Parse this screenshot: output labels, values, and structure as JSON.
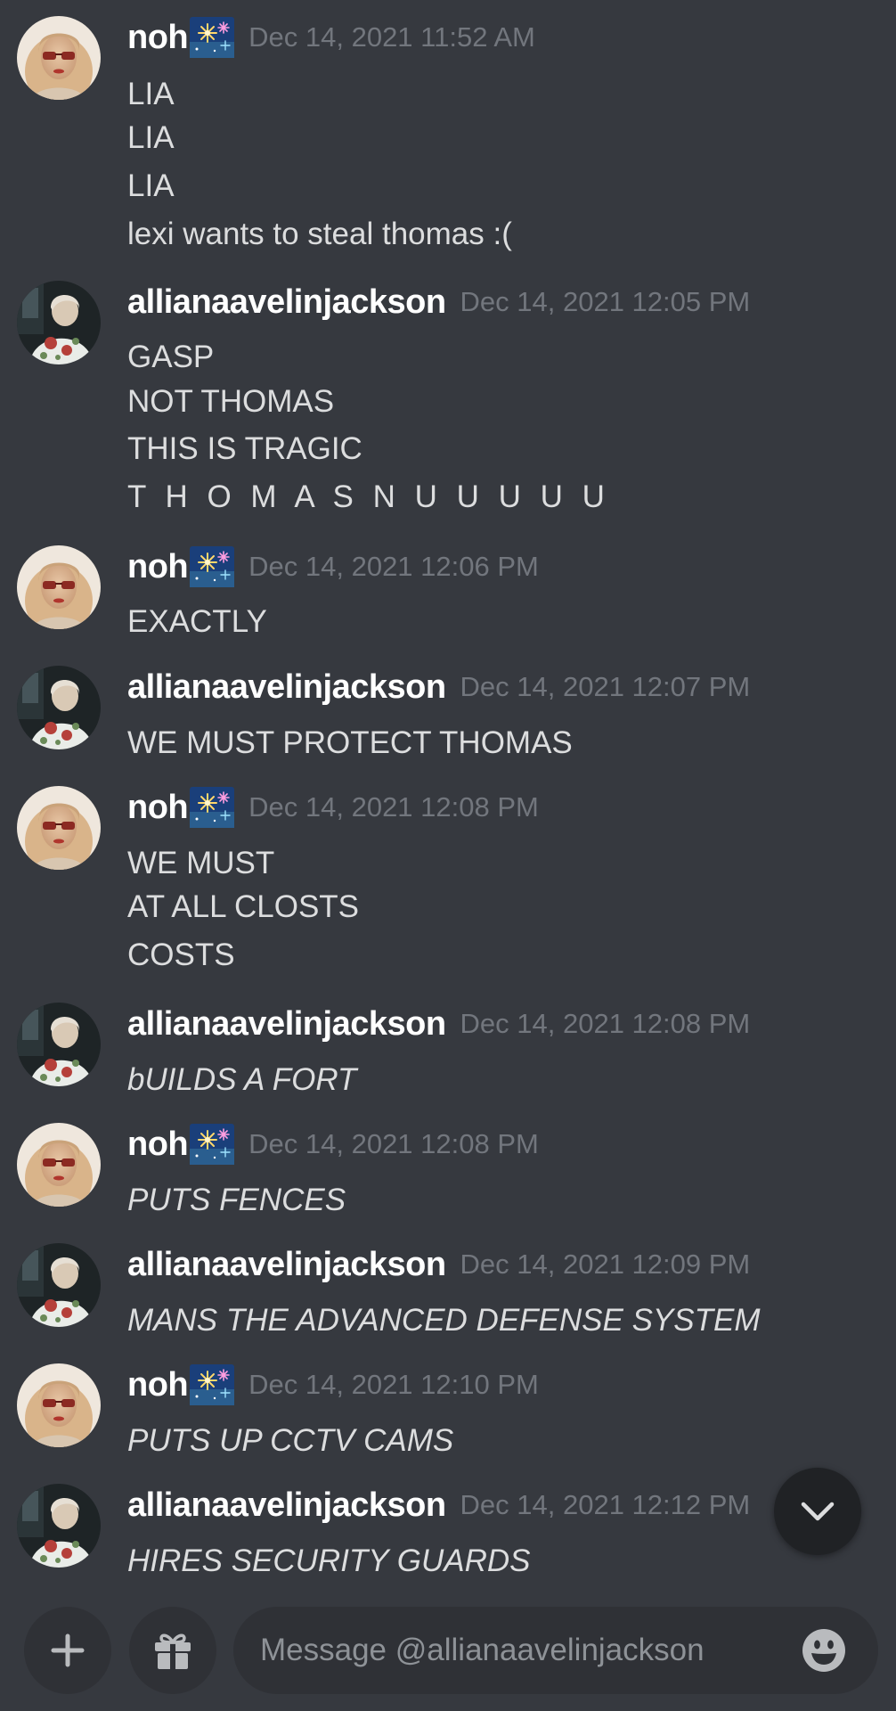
{
  "messages": [
    {
      "username": "noh",
      "has_emoji": true,
      "timestamp": "Dec 14, 2021 11:52 AM",
      "lines": [
        "LIA",
        "LIA",
        "LIA",
        "lexi wants to steal thomas :("
      ]
    },
    {
      "username": "allianaavelinjackson",
      "has_emoji": false,
      "timestamp": "Dec 14, 2021 12:05 PM",
      "lines": [
        "GASP",
        "NOT THOMAS",
        "THIS IS TRAGIC",
        "T H O M A S N U U U U U"
      ]
    },
    {
      "username": "noh",
      "has_emoji": true,
      "timestamp": "Dec 14, 2021 12:06 PM",
      "lines": [
        "EXACTLY"
      ]
    },
    {
      "username": "allianaavelinjackson",
      "has_emoji": false,
      "timestamp": "Dec 14, 2021 12:07 PM",
      "lines": [
        "WE MUST PROTECT THOMAS"
      ]
    },
    {
      "username": "noh",
      "has_emoji": true,
      "timestamp": "Dec 14, 2021 12:08 PM",
      "lines": [
        "WE MUST",
        "AT ALL CLOSTS",
        "COSTS"
      ]
    },
    {
      "username": "allianaavelinjackson",
      "has_emoji": false,
      "timestamp": "Dec 14, 2021 12:08 PM",
      "lines": [
        "bUILDS A FORT"
      ]
    },
    {
      "username": "noh",
      "has_emoji": true,
      "timestamp": "Dec 14, 2021 12:08 PM",
      "lines": [
        "PUTS FENCES"
      ]
    },
    {
      "username": "allianaavelinjackson",
      "has_emoji": false,
      "timestamp": "Dec 14, 2021 12:09 PM",
      "lines": [
        "MANS THE ADVANCED DEFENSE SYSTEM"
      ]
    },
    {
      "username": "noh",
      "has_emoji": true,
      "timestamp": "Dec 14, 2021 12:10 PM",
      "lines": [
        "PUTS UP CCTV CAMS"
      ]
    },
    {
      "username": "allianaavelinjackson",
      "has_emoji": false,
      "timestamp": "Dec 14, 2021 12:12 PM",
      "lines": [
        "HIRES SECURITY GUARDS"
      ]
    }
  ],
  "composer": {
    "placeholder": "Message @allianaavelinjackson"
  },
  "icons": {
    "scroll": "chevron-down-icon",
    "attach": "plus-icon",
    "gift": "gift-icon",
    "emoji": "smiley-icon",
    "username_emoji": "fireworks-icon"
  },
  "colors": {
    "background": "#36393f",
    "input_background": "#2f3136",
    "username": "#ffffff",
    "timestamp": "#72767d",
    "text": "#dcddde"
  }
}
